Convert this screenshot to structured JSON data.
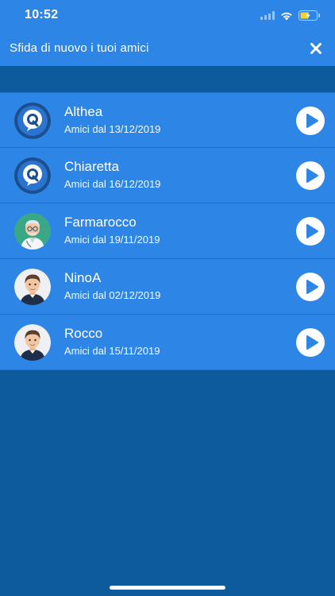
{
  "status_bar": {
    "time": "10:52"
  },
  "nav": {
    "title": "Sfida di nuovo i tuoi amici"
  },
  "friends": [
    {
      "name": "Althea",
      "since": "Amici dal 13/12/2019",
      "avatar": "q-logo-icon"
    },
    {
      "name": "Chiaretta",
      "since": "Amici dal 16/12/2019",
      "avatar": "q-logo-icon"
    },
    {
      "name": "Farmarocco",
      "since": "Amici dal 19/11/2019",
      "avatar": "pharmacist-avatar-icon"
    },
    {
      "name": "NinoA",
      "since": "Amici dal 02/12/2019",
      "avatar": "man-avatar-icon"
    },
    {
      "name": "Rocco",
      "since": "Amici dal 15/11/2019",
      "avatar": "man-avatar-icon"
    }
  ],
  "colors": {
    "background": "#0d5a9c",
    "header": "#2d86e6",
    "row": "#2d86e6",
    "row_divider": "#1f6fc9",
    "play_icon": "#2d86e6"
  }
}
